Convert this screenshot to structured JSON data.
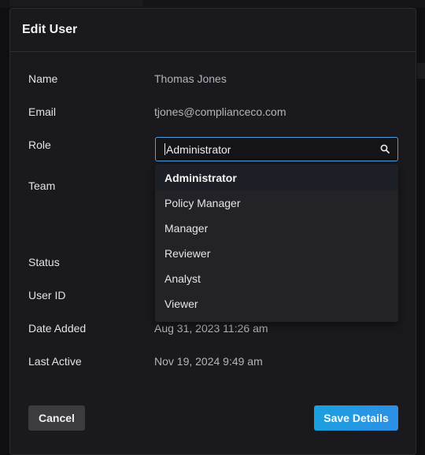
{
  "modal": {
    "title": "Edit User"
  },
  "fields": {
    "name_label": "Name",
    "name_value": "Thomas Jones",
    "email_label": "Email",
    "email_value": "tjones@complianceco.com",
    "role_label": "Role",
    "team_label": "Team",
    "status_label": "Status",
    "userid_label": "User ID",
    "date_added_label": "Date Added",
    "date_added_value": "Aug 31, 2023 11:26 am",
    "last_active_label": "Last Active",
    "last_active_value": "Nov 19, 2024 9:49 am"
  },
  "role_input": {
    "value": "Administrator",
    "icon": "search-icon"
  },
  "role_options": [
    {
      "label": "Administrator",
      "selected": true
    },
    {
      "label": "Policy Manager",
      "selected": false
    },
    {
      "label": "Manager",
      "selected": false
    },
    {
      "label": "Reviewer",
      "selected": false
    },
    {
      "label": "Analyst",
      "selected": false
    },
    {
      "label": "Viewer",
      "selected": false
    }
  ],
  "buttons": {
    "cancel": "Cancel",
    "save": "Save Details"
  },
  "colors": {
    "accent": "#2d8fe6",
    "focus_border": "#4d9fe0",
    "background": "#1a1a1e"
  }
}
